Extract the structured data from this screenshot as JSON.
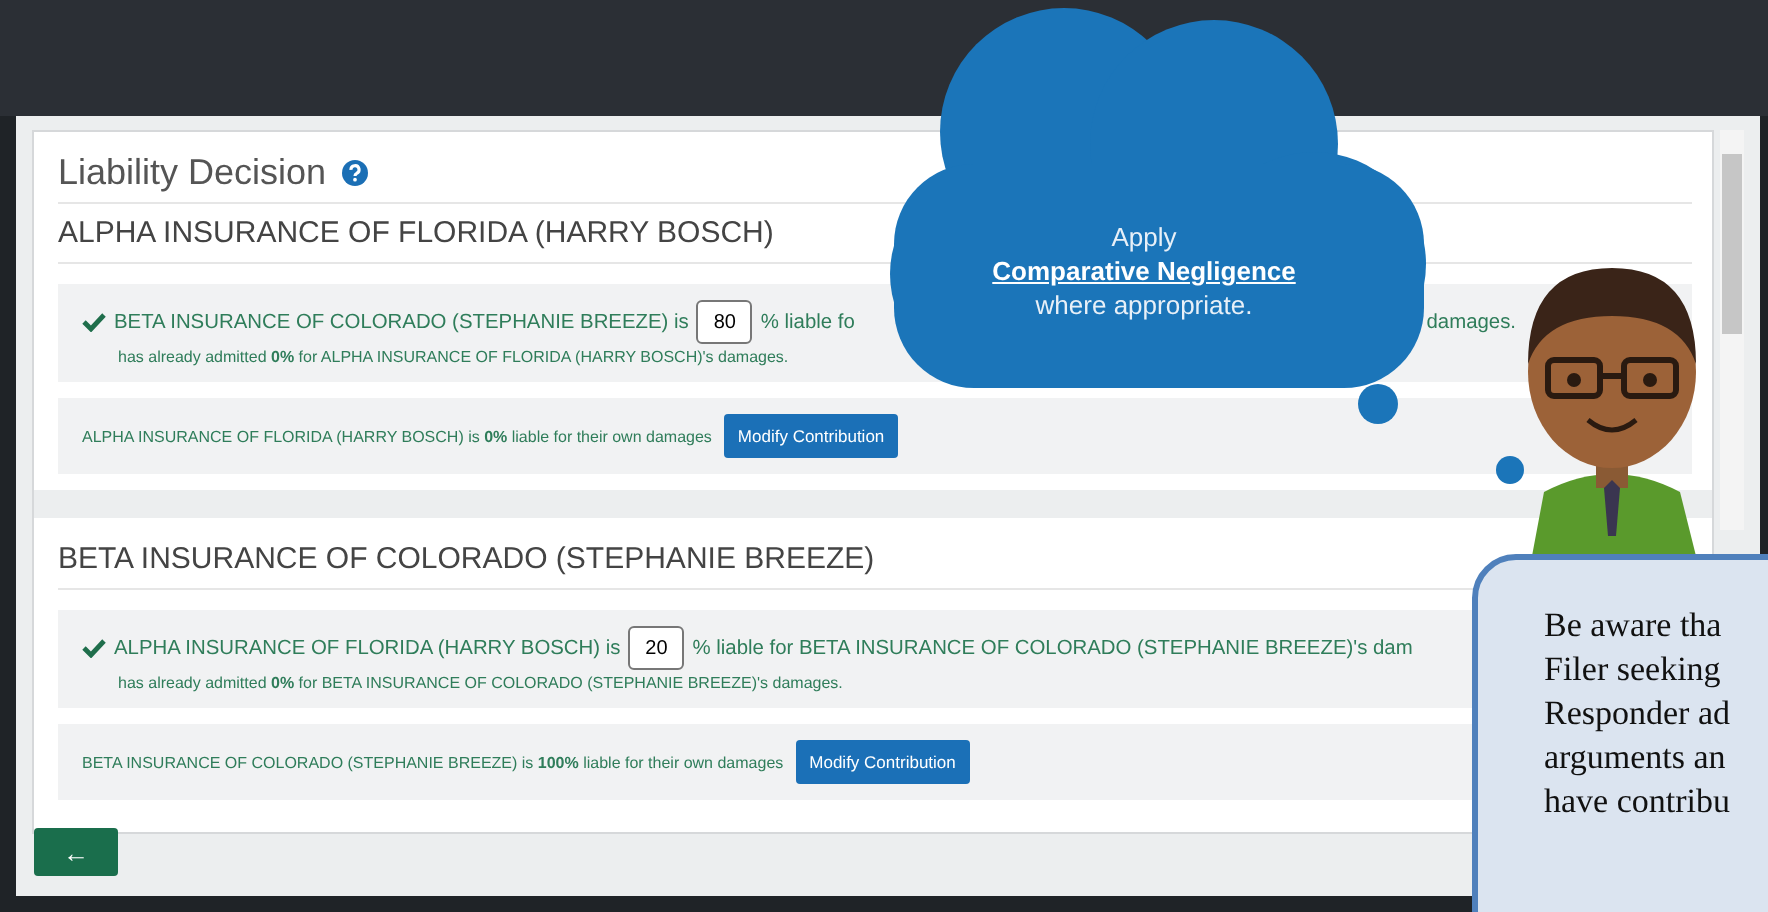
{
  "heading": "Liability Decision",
  "sections": [
    {
      "title": "ALPHA INSURANCE OF FLORIDA (HARRY BOSCH)",
      "claim": {
        "checked": true,
        "lead": "BETA INSURANCE OF COLORADO (STEPHANIE BREEZE) is",
        "value": "80",
        "tail": "% liable fo",
        "end": "damages.",
        "note": "has already admitted **0%** for ALPHA INSURANCE OF FLORIDA (HARRY BOSCH)'s damages."
      },
      "own": {
        "text": "ALPHA INSURANCE OF FLORIDA (HARRY BOSCH) is **0%** liable for their own damages",
        "button": "Modify Contribution"
      }
    },
    {
      "title": "BETA INSURANCE OF COLORADO (STEPHANIE BREEZE)",
      "claim": {
        "checked": true,
        "lead": "ALPHA INSURANCE OF FLORIDA (HARRY BOSCH) is",
        "value": "20",
        "tail": "% liable for BETA INSURANCE OF COLORADO (STEPHANIE BREEZE)'s dam",
        "note": "has already admitted **0%** for BETA INSURANCE OF COLORADO (STEPHANIE BREEZE)'s damages."
      },
      "own": {
        "text": "BETA INSURANCE OF COLORADO (STEPHANIE BREEZE) is **100%** liable for their own damages",
        "button": "Modify Contribution"
      }
    }
  ],
  "back_button": "←",
  "cloud": {
    "top": "Apply",
    "link": "Comparative Negligence",
    "bottom": "where appropriate."
  },
  "callout": {
    "lines": [
      "Be aware tha",
      "Filer seeking",
      "Responder ad",
      "arguments an",
      "have contribu"
    ]
  }
}
